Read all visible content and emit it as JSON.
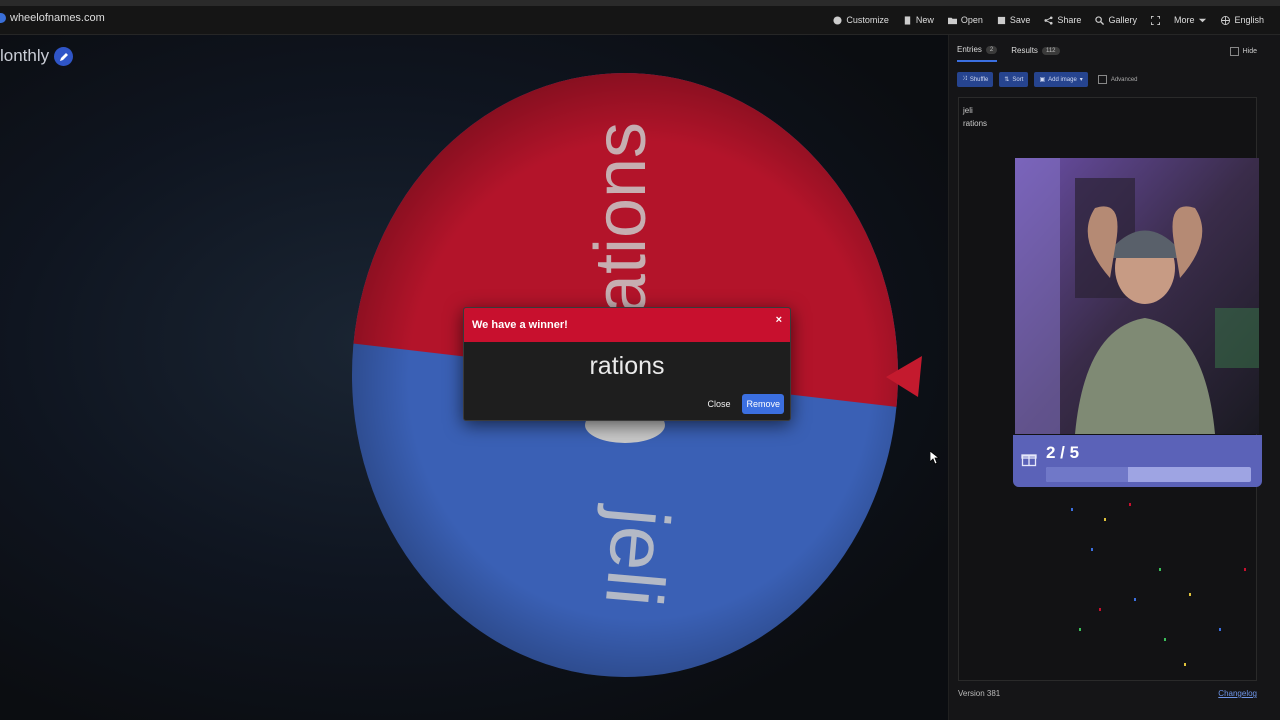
{
  "browser": {
    "site": "wheelofnames.com"
  },
  "nav": {
    "items": [
      {
        "label": "Customize",
        "icon": "palette-icon"
      },
      {
        "label": "New",
        "icon": "file-icon"
      },
      {
        "label": "Open",
        "icon": "folder-icon"
      },
      {
        "label": "Save",
        "icon": "save-icon"
      },
      {
        "label": "Share",
        "icon": "share-icon"
      },
      {
        "label": "Gallery",
        "icon": "search-icon"
      },
      {
        "label": "",
        "icon": "fullscreen-icon"
      },
      {
        "label": "More",
        "icon": "chevron-down-icon"
      },
      {
        "label": "English",
        "icon": "globe-icon"
      }
    ]
  },
  "wheel": {
    "title": "lonthly",
    "segments": [
      {
        "label": "rations",
        "color": "#b3142a"
      },
      {
        "label": "jeli",
        "color": "#3a60b5"
      }
    ]
  },
  "dialog": {
    "header": "We have a winner!",
    "close_x": "×",
    "winner": "rations",
    "close_label": "Close",
    "remove_label": "Remove"
  },
  "panel": {
    "tabs": [
      {
        "label": "Entries",
        "badge": "2"
      },
      {
        "label": "Results",
        "badge": "112"
      }
    ],
    "hide_label": "Hide",
    "toolbar": {
      "shuffle": "Shuffle",
      "sort": "Sort",
      "add_image": "Add image",
      "advanced": "Advanced"
    },
    "entries": [
      "jeli",
      "rations"
    ],
    "version": "Version 381",
    "changelog": "Changelog"
  },
  "overlay": {
    "goal_text": "2 / 5",
    "goal_progress": 0.4
  },
  "colors": {
    "accent": "#3b6fe0",
    "winner_header": "#c8102e",
    "goal": "#5b62b8"
  }
}
